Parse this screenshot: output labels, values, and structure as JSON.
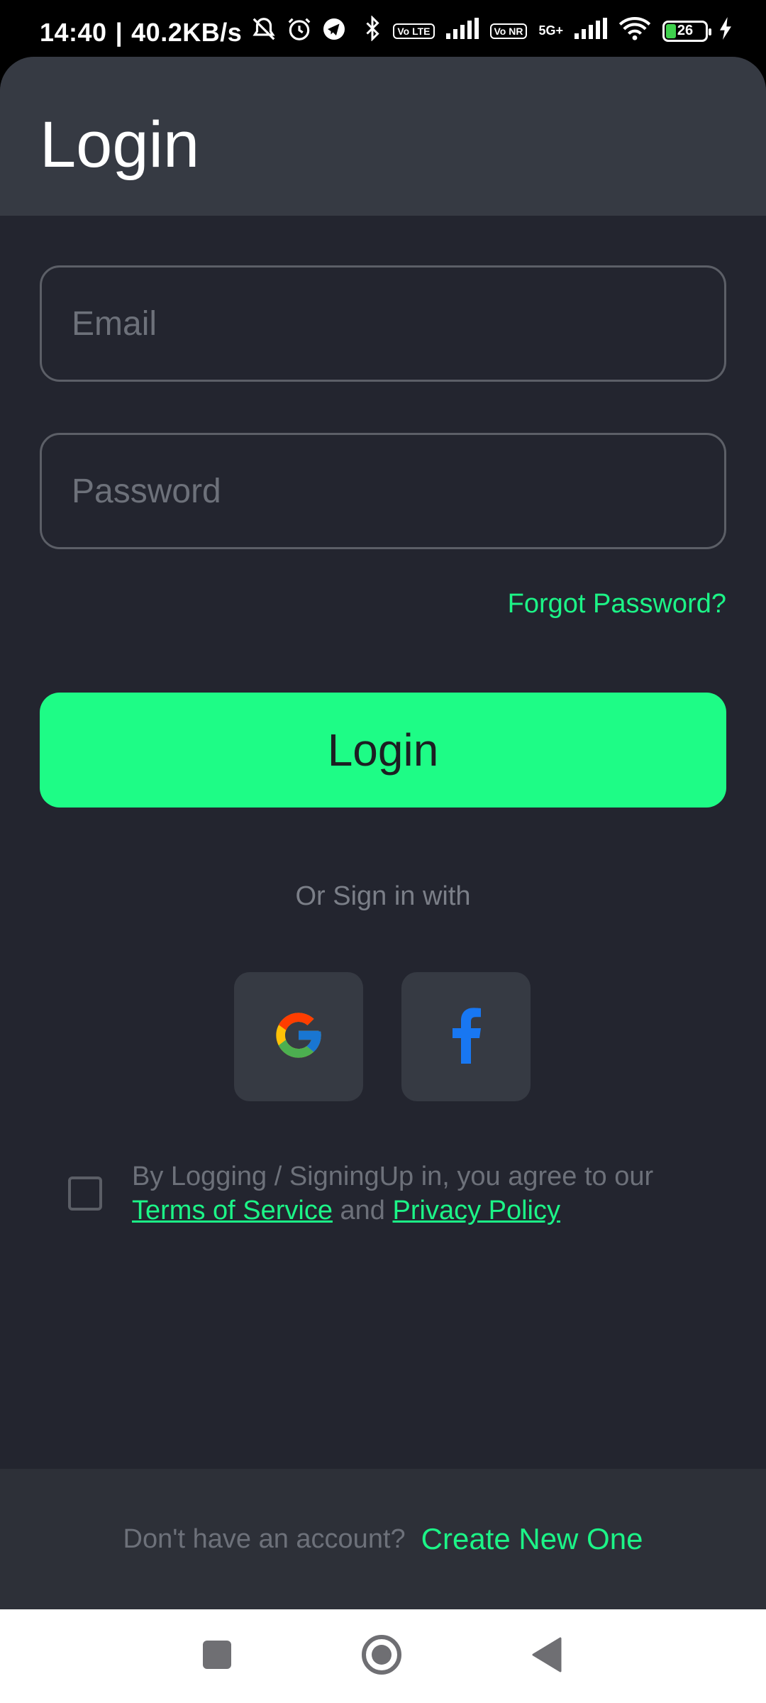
{
  "status_bar": {
    "time": "14:40",
    "separator": "|",
    "speed": "40.2KB/s",
    "volte1": "Vo LTE",
    "volte2": "Vo NR",
    "net": "5G+",
    "battery": "26"
  },
  "header": {
    "title": "Login"
  },
  "form": {
    "email_placeholder": "Email",
    "password_placeholder": "Password",
    "forgot_label": "Forgot Password?",
    "login_label": "Login"
  },
  "social": {
    "or_text": "Or Sign in with"
  },
  "terms": {
    "prefix": "By Logging / SigningUp in, you agree to our",
    "tos_label": "Terms of Service",
    "and": "and",
    "privacy_label": "Privacy Policy"
  },
  "footer": {
    "question": "Don't have an account?",
    "create_label": "Create New One"
  },
  "colors": {
    "accent": "#1efc86",
    "background": "#23252f",
    "header": "#363a43"
  },
  "icons": {
    "google": "google-icon",
    "facebook": "facebook-icon"
  }
}
